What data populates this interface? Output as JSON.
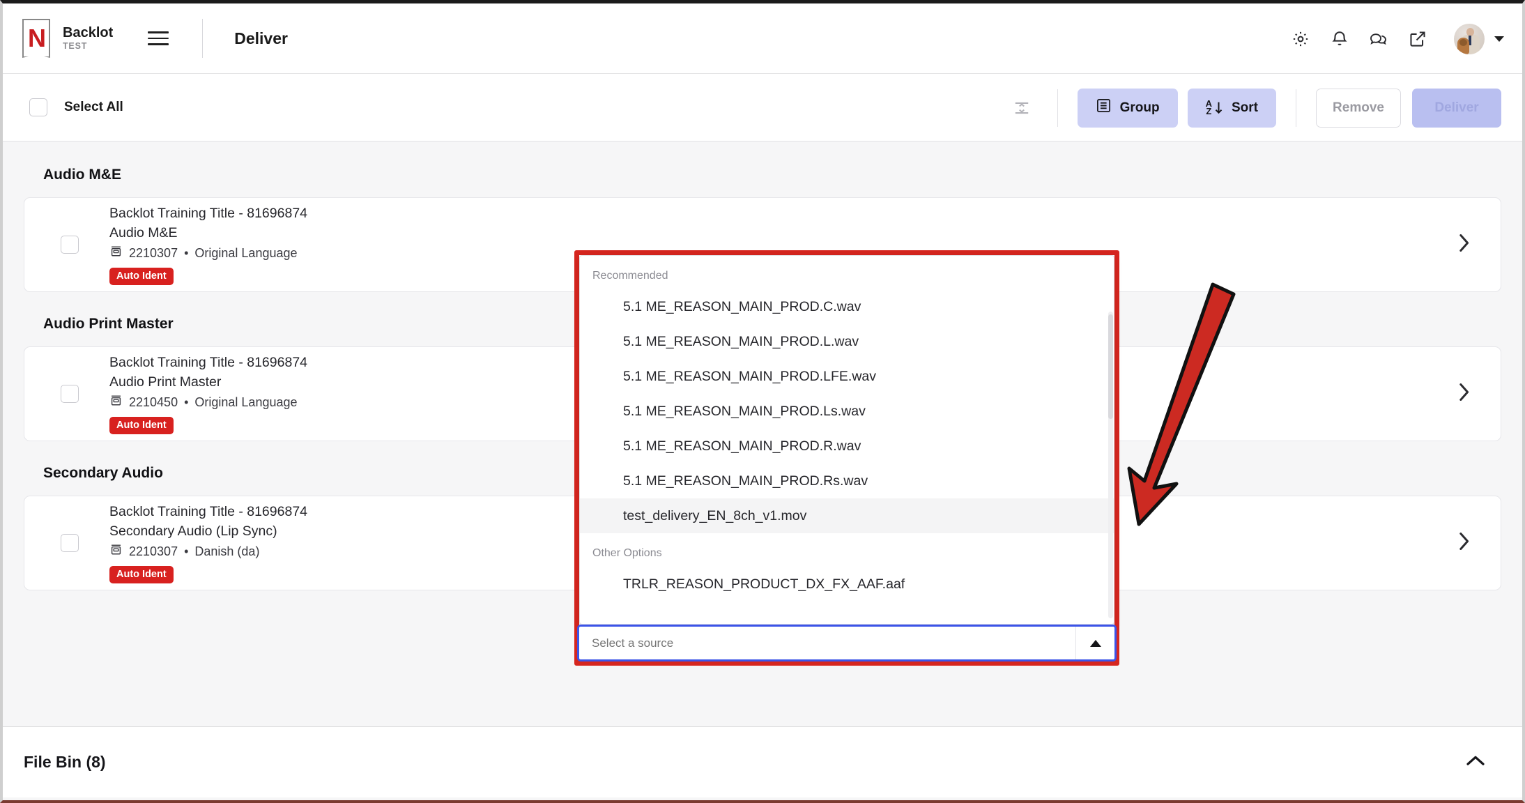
{
  "header": {
    "brand_name": "Backlot",
    "brand_sub": "TEST",
    "page_title": "Deliver",
    "icons": [
      "gear-icon",
      "bell-icon",
      "chat-icon",
      "external-link-icon"
    ]
  },
  "actionbar": {
    "select_all_label": "Select All",
    "collapse_icon": "collapse-rows-icon",
    "group_label": "Group",
    "sort_label": "Sort",
    "sort_glyph_top": "A",
    "sort_glyph_bottom": "Z",
    "remove_label": "Remove",
    "deliver_label": "Deliver",
    "accent_group": "#ccd0f5",
    "accent_deliver": "#b9bff0"
  },
  "groups": [
    {
      "heading": "Audio M&E",
      "row": {
        "title": "Backlot Training Title - 81696874",
        "subtitle": "Audio M&E",
        "meta_id": "2210307",
        "meta_sep": "•",
        "meta_lang": "Original Language",
        "badge": "Auto Ident",
        "badge_color": "#d8211f"
      }
    },
    {
      "heading": "Audio Print Master",
      "row": {
        "title": "Backlot Training Title - 81696874",
        "subtitle": "Audio Print Master",
        "meta_id": "2210450",
        "meta_sep": "•",
        "meta_lang": "Original Language",
        "badge": "Auto Ident",
        "badge_color": "#d8211f"
      }
    },
    {
      "heading": "Secondary Audio",
      "row": {
        "title": "Backlot Training Title - 81696874",
        "subtitle": "Secondary Audio (Lip Sync)",
        "meta_id": "2210307",
        "meta_sep": "•",
        "meta_lang": "Danish (da)",
        "badge": "Auto Ident",
        "badge_color": "#d8211f"
      }
    }
  ],
  "dropdown": {
    "recommended_label": "Recommended",
    "other_label": "Other Options",
    "recommended": [
      "5.1 ME_REASON_MAIN_PROD.C.wav",
      "5.1 ME_REASON_MAIN_PROD.L.wav",
      "5.1 ME_REASON_MAIN_PROD.LFE.wav",
      "5.1 ME_REASON_MAIN_PROD.Ls.wav",
      "5.1 ME_REASON_MAIN_PROD.R.wav",
      "5.1 ME_REASON_MAIN_PROD.Rs.wav",
      "test_delivery_EN_8ch_v1.mov"
    ],
    "highlighted_index": 6,
    "other": [
      "TRLR_REASON_PRODUCT_DX_FX_AAF.aaf"
    ],
    "select_value": "",
    "select_placeholder": "Select a source",
    "select_caret": "caret-up-icon",
    "highlight_border_color": "#d6261f",
    "focus_border_color": "#3c54e8"
  },
  "filebin": {
    "title": "File Bin (8)",
    "chevron": "chevron-up-icon"
  },
  "annotation": {
    "type": "arrow",
    "color": "#cc2a22"
  }
}
